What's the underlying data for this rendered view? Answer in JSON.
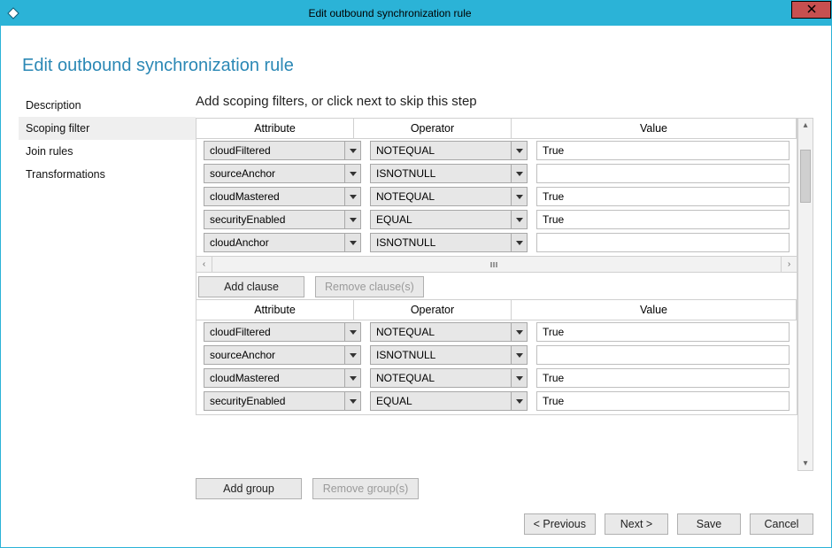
{
  "window": {
    "title": "Edit outbound synchronization rule"
  },
  "heading": "Edit outbound synchronization rule",
  "sidebar": {
    "items": [
      {
        "label": "Description",
        "selected": false
      },
      {
        "label": "Scoping filter",
        "selected": true
      },
      {
        "label": "Join rules",
        "selected": false
      },
      {
        "label": "Transformations",
        "selected": false
      }
    ]
  },
  "main": {
    "instruction": "Add scoping filters, or click next to skip this step",
    "columns": {
      "attribute": "Attribute",
      "operator": "Operator",
      "value": "Value"
    },
    "groups": [
      {
        "rows": [
          {
            "attribute": "cloudFiltered",
            "operator": "NOTEQUAL",
            "value": "True"
          },
          {
            "attribute": "sourceAnchor",
            "operator": "ISNOTNULL",
            "value": ""
          },
          {
            "attribute": "cloudMastered",
            "operator": "NOTEQUAL",
            "value": "True"
          },
          {
            "attribute": "securityEnabled",
            "operator": "EQUAL",
            "value": "True"
          },
          {
            "attribute": "cloudAnchor",
            "operator": "ISNOTNULL",
            "value": ""
          }
        ],
        "buttons": {
          "add_clause": "Add clause",
          "remove_clauses": "Remove clause(s)"
        }
      },
      {
        "rows": [
          {
            "attribute": "cloudFiltered",
            "operator": "NOTEQUAL",
            "value": "True"
          },
          {
            "attribute": "sourceAnchor",
            "operator": "ISNOTNULL",
            "value": ""
          },
          {
            "attribute": "cloudMastered",
            "operator": "NOTEQUAL",
            "value": "True"
          },
          {
            "attribute": "securityEnabled",
            "operator": "EQUAL",
            "value": "True"
          }
        ]
      }
    ],
    "group_buttons": {
      "add_group": "Add group",
      "remove_groups": "Remove group(s)"
    }
  },
  "footer": {
    "previous": "< Previous",
    "next": "Next >",
    "save": "Save",
    "cancel": "Cancel"
  }
}
